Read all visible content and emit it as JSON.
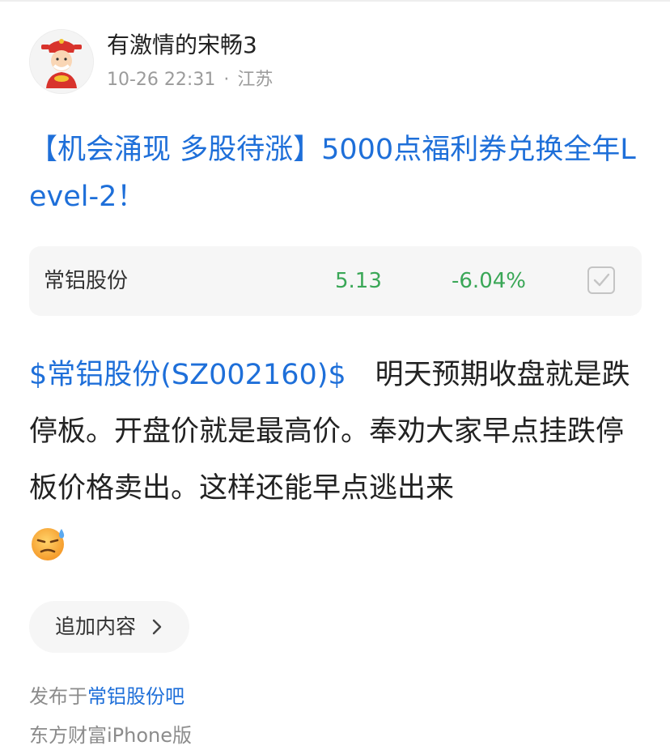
{
  "author": {
    "name": "有激情的宋畅3",
    "avatar_icon": "fortune-god-avatar",
    "timestamp": "10-26 22:31",
    "separator": "·",
    "location": "江苏"
  },
  "post": {
    "title": "【机会涌现 多股待涨】5000点福利券兑换全年Level-2！",
    "body_stock_link": "$常铝股份(SZ002160)$",
    "body_text": "明天预期收盘就是跌停板。开盘价就是最高价。奉劝大家早点挂跌停板价格卖出。这样还能早点逃出来",
    "body_emoji_icon": "sweat-smile-emoji-icon"
  },
  "stock_card": {
    "name": "常铝股份",
    "price": "5.13",
    "change": "-6.04%",
    "change_color": "#3aa757",
    "check_icon": "checkbox-check-icon"
  },
  "actions": {
    "append_label": "追加内容"
  },
  "footer": {
    "published_prefix": "发布于",
    "bar_name": "常铝股份吧",
    "client": "东方财富iPhone版"
  },
  "colors": {
    "link_blue": "#1e6fd9",
    "down_green": "#3aa757",
    "meta_gray": "#9b9b9b",
    "card_bg": "#f6f6f6"
  }
}
